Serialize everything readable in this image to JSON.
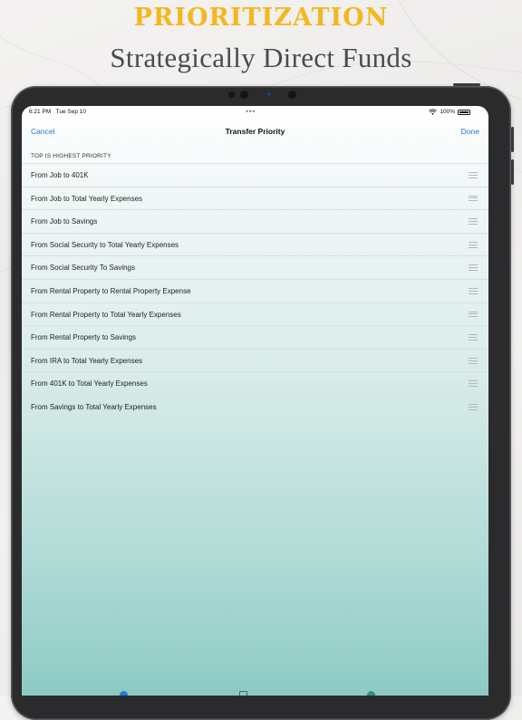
{
  "headline": "PRIORITIZATION",
  "subheadline": "Strategically Direct Funds",
  "status_bar": {
    "time": "6:21 PM",
    "date": "Tue Sep 10",
    "battery": "100%",
    "multitask": "•••"
  },
  "nav": {
    "cancel": "Cancel",
    "title": "Transfer Priority",
    "done": "Done"
  },
  "section_header": "TOP IS HIGHEST PRIORITY",
  "rows": [
    "From Job to 401K",
    "From Job to Total Yearly Expenses",
    "From Job to Savings",
    "From Social Security to Total Yearly Expenses",
    "From Social Security To Savings",
    "From Rental Property to Rental Property Expense",
    "From Rental Property to Total Yearly Expenses",
    "From Rental Property to Savings",
    "From IRA to Total Yearly Expenses",
    "From 401K to Total Yearly Expenses",
    "From Savings to Total Yearly Expenses"
  ],
  "colors": {
    "headline": "#f4b81e",
    "accent": "#1a7de0",
    "screen_bottom": "#8dcac4"
  }
}
